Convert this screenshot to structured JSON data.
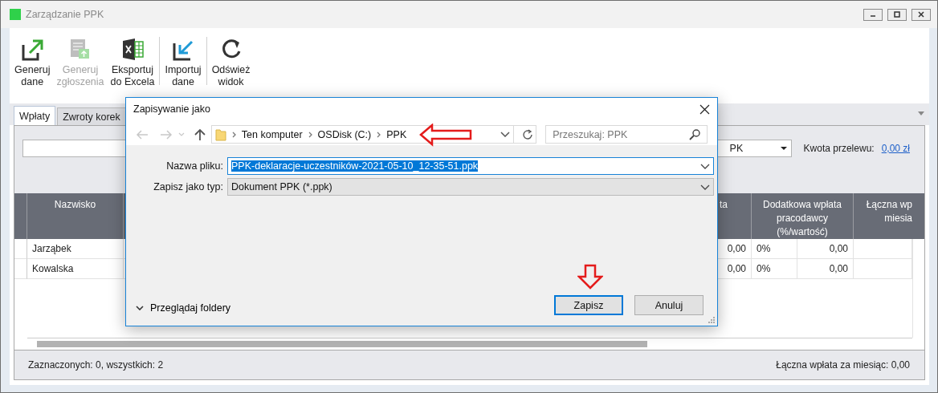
{
  "window": {
    "title": "Zarządzanie PPK"
  },
  "toolbar": [
    {
      "label": "Generuj\ndane",
      "kind": "export",
      "disabled": false,
      "separator_after": false
    },
    {
      "label": "Generuj\nzgłoszenia",
      "kind": "report",
      "disabled": true,
      "separator_after": false
    },
    {
      "label": "Eksportuj\ndo Excela",
      "kind": "excel",
      "disabled": false,
      "separator_after": true
    },
    {
      "label": "Importuj\ndane",
      "kind": "import",
      "disabled": false,
      "separator_after": true
    },
    {
      "label": "Odśwież\nwidok",
      "kind": "refresh",
      "disabled": false,
      "separator_after": false
    }
  ],
  "tabs": [
    {
      "label": "Wpłaty",
      "selected": true
    },
    {
      "label": "Zwroty korek",
      "selected": false
    }
  ],
  "filter": {
    "plan_select": "PK",
    "transfer_label": "Kwota przelewu:",
    "transfer_link": "0,00 zł"
  },
  "table": {
    "columns": [
      "Nazwisko",
      "ta",
      "Dodatkowa wpłata\npracodawcy\n(%/wartość)",
      "Łączna wp\nmiesia"
    ],
    "rows": [
      {
        "name": "Jarząbek",
        "column_2": "0,00",
        "percent": "0%",
        "value": "0,00"
      },
      {
        "name": "Kowalska",
        "column_2": "0,00",
        "percent": "0%",
        "value": "0,00"
      }
    ]
  },
  "status_bar": {
    "left": "Zaznaczonych: 0, wszystkich: 2",
    "right": "Łączna wpłata za miesiąc: 0,00"
  },
  "dialog": {
    "title": "Zapisywanie jako",
    "path": [
      "Ten komputer",
      "OSDisk (C:)",
      "PPK"
    ],
    "search": {
      "placeholder": "Przeszukaj: PPK"
    },
    "fields": [
      {
        "label": "Nazwa pliku:",
        "value": "PPK-deklaracje-uczestników-2021-05-10_12-35-51.ppk",
        "kind": "text",
        "focused": true
      },
      {
        "label": "Zapisz jako typ:",
        "value": "Dokument PPK (*.ppk)",
        "kind": "select",
        "focused": false
      }
    ],
    "browse": "Przeglądaj foldery",
    "buttons": [
      {
        "label": "Zapisz",
        "default": true
      },
      {
        "label": "Anuluj",
        "default": false
      }
    ]
  }
}
